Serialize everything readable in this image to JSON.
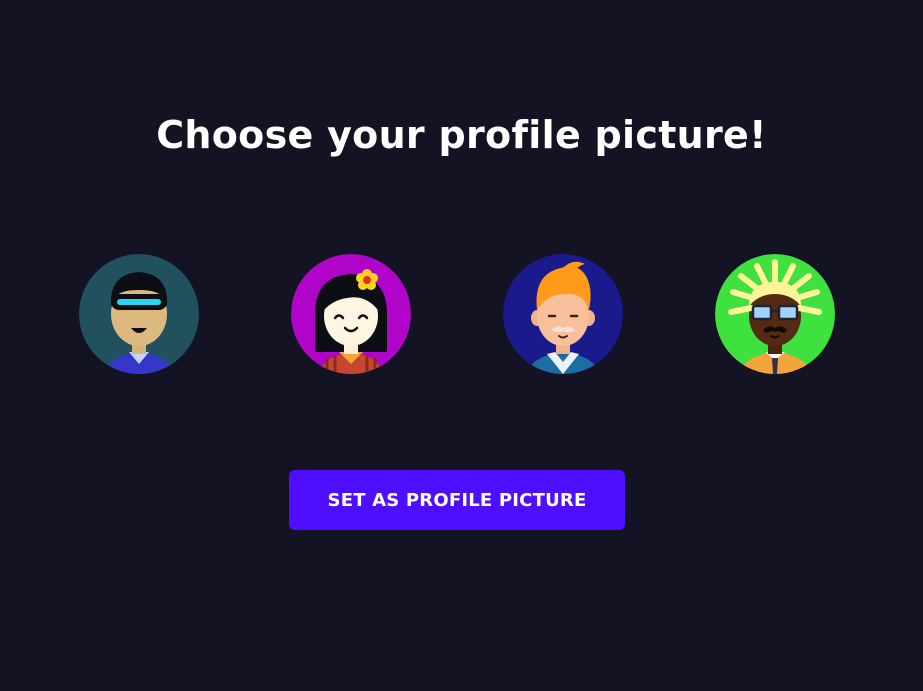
{
  "heading": "Choose your profile picture!",
  "avatars": [
    {
      "icon": "robot-visor-avatar-icon",
      "bg": "#21515f"
    },
    {
      "icon": "girl-flower-avatar-icon",
      "bg": "#b004c9"
    },
    {
      "icon": "old-man-mustache-avatar-icon",
      "bg": "#1a1a8d"
    },
    {
      "icon": "dreadlocks-glasses-avatar-icon",
      "bg": "#3fe13f"
    }
  ],
  "button": {
    "label": "SET AS PROFILE PICTURE"
  },
  "colors": {
    "background": "#131324",
    "accent": "#4e0eff",
    "text": "#ffffff"
  }
}
